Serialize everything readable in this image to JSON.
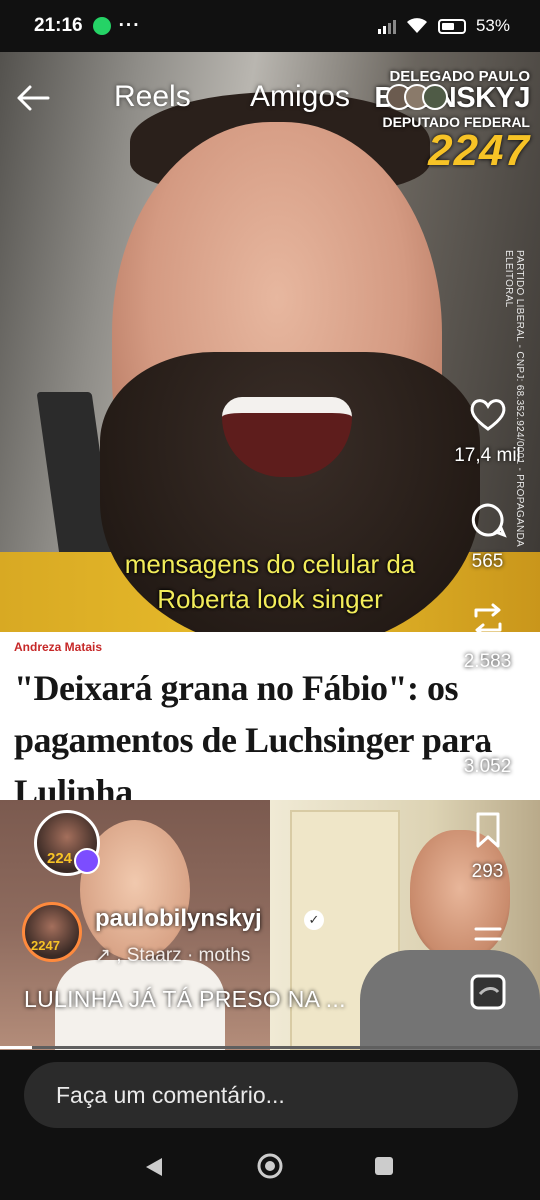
{
  "status": {
    "time": "21:16",
    "battery": "53%"
  },
  "top": {
    "tab_reels": "Reels",
    "tab_friends": "Amigos"
  },
  "promo": {
    "line1": "DELEGADO PAULO",
    "line2": "BILYNSKYJ",
    "line3": "DEPUTADO FEDERAL",
    "number": "2247"
  },
  "vertical_text": "PARTIDO LIBERAL - CNPJ: 68.352.924/0001 - PROPAGANDA ELEITORAL",
  "caption": {
    "line1": "mensagens do celular da",
    "line2": "Roberta look singer"
  },
  "news": {
    "author": "Andreza Matais",
    "headline_line1": "\"Deixará grana no Fábio\": os",
    "headline_line2": "pagamentos de Luchsinger para",
    "headline_line3": "Lulinha"
  },
  "actions": {
    "likes": "17,4 mil",
    "comments": "565",
    "reposts": "2.583",
    "shares": "3.052",
    "saves": "293"
  },
  "author": {
    "username": "paulobilynskyj",
    "music": ", Staarz · moths",
    "avatar_badge": "2247",
    "avatar_badge_top": "224",
    "description": "LULINHA JÁ TÁ PRESO NA ..."
  },
  "comment": {
    "placeholder": "Faça um comentário..."
  },
  "colors": {
    "accent_yellow": "#f7c326",
    "caption_yellow": "#f2ec5a",
    "news_red": "#c62828",
    "repost_purple": "#7c4dff"
  },
  "icons": [
    "back-arrow-icon",
    "heart-icon",
    "comment-icon",
    "repost-icon",
    "share-icon",
    "bookmark-icon",
    "more-icon",
    "music-thumbnail-icon",
    "whatsapp-icon",
    "wifi-icon",
    "battery-icon"
  ]
}
